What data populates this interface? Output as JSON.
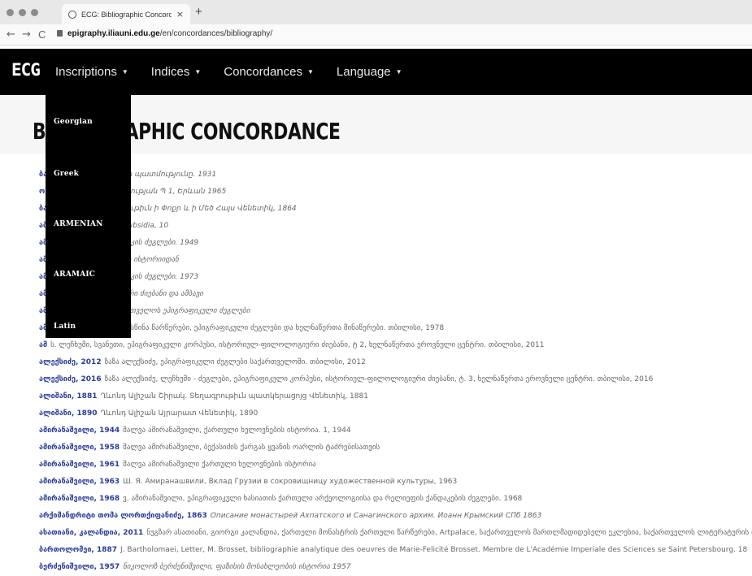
{
  "browser": {
    "tab_title": "ECG: Bibliographic Concordan",
    "tab_close": "×",
    "new_tab": "+",
    "url_domain": "epigraphy.iliauni.edu.ge",
    "url_path": "/en/concordances/bibliography/",
    "back": "←",
    "forward": "→",
    "reload": "C"
  },
  "nav": {
    "brand": "ECG",
    "menu": [
      {
        "label": "Inscriptions"
      },
      {
        "label": "Indices"
      },
      {
        "label": "Concordances"
      },
      {
        "label": "Language"
      }
    ],
    "caret": "▼"
  },
  "page": {
    "title": "BIBLIOGRAPHIC CONCORDANCE"
  },
  "dropdown": {
    "items": [
      "Georgian",
      "Greek",
      "ARMENIAN",
      "ARAMAIC",
      "Latin"
    ]
  },
  "rows": [
    {
      "key": "ბა",
      "text": "Ալիշան, Հայաստանի պատմությունը. 1931"
    },
    {
      "key": "ო",
      "text": "ի Դիվան հայ վիմագրության Պ 1, Երևան 1965"
    },
    {
      "key": "ბა",
      "text": "Սիրանյան, Տեղագրութիւն ի Փոքր և ի Մեծ Հայս Վենետիկ, 1864"
    },
    {
      "key": "ამ",
      "text": "MIA CSCO. Vol 166. Subsidia, 10"
    },
    {
      "key": "ამ",
      "text": "ს. ქართული ეპიგრაფიკის ძეგლები. 1949"
    },
    {
      "key": "ამ",
      "text": "დეპები. საქართველოს ისტორიიდან"
    },
    {
      "key": "ამ",
      "text": "ს. ქართული ეპიგრაფიკის ძეგლები. 1973"
    },
    {
      "key": "ამ",
      "text": "დეპები. არქეოლოგიური ძიებანი და ამბავი"
    },
    {
      "key": "ამ",
      "text": "ს. აღმოსავლეთ საქართველოს ეპიგრაფიკული ძეგლები"
    },
    {
      "key": "ამ",
      "text": "ს. აქები სიონის ბოლოსწინა წარწერები, ეპიგრაფიკული ძეგლები და ხელნაწერთა მინაწერები. თბილისი, 1978"
    },
    {
      "key": "ამ",
      "text": "ს. ლეჩხუმი, სვანეთი, ეპიგრაფიკული კორპუსი, ისტორიულ-ფილოლოგიური ძიებანი, ტ 2, ხელნაწერთა ეროვნული ცენტრი. თბილისი, 2011"
    },
    {
      "key": "ალექსიძე, 2012",
      "text": "ზაზა ალექსიძე, ეპიგრაფიკული ძეგლები საქართველოში. თბილისი, 2012"
    },
    {
      "key": "ალექსიძე, 2016",
      "text": "ზაზა ალექსიძე, ლეჩხუმი - ძეგლები, ეპიგრაფიკული კორპუსი, ისტორიულ-ფილოლოგიური ძიებანი, ტ. 3, ხელნაწერთა ეროვნული ცენტრი. თბილისი, 2016"
    },
    {
      "key": "ალიშანი, 1881",
      "text": "Ղևոնդ Ալիշան Շիրակ. Տեղագրութիւն պատկերացոյց Վենետիկ, 1881"
    },
    {
      "key": "ალიშანი, 1890",
      "text": "Ղևոնդ Ալիշան Այրարատ Վենետիկ, 1890"
    },
    {
      "key": "ამირანაშვილი, 1944",
      "text": "შალვა ამირანაშვილი, ქართული ხელოვნების ისტორია. 1, 1944"
    },
    {
      "key": "ამირანაშვილი, 1958",
      "text": "შალვა ამირანაშვილი, ბექასიძის ქარგას ყვანის ოარლის ტაძრებისათვის"
    },
    {
      "key": "ამირანაშვილი, 1961",
      "text": "შალვა ამირანაშვილი ქართული ხელოვნების ისტორია"
    },
    {
      "key": "ამირანაშვილი, 1963",
      "text": "Ш. Я. Амиранашвили, Вклад Грузии в сокровищницу художественной культуры, 1963"
    },
    {
      "key": "ამირანაშვილი, 1968",
      "text": "ვ. ამირანაშვილი, ეპიგრაფიკული ხასიათის ქართული არქეოლოგიისა და რელიეფის ქანდაკების ძეგლები. 1968"
    },
    {
      "key": "არქიმანდრიტი თომა ლორთქიფანიძე, 1863",
      "text": "Описание монастырей Ахпатского и Санагинского архим. Иоанн Крымский СПб 1863"
    },
    {
      "key": "ასათიანი, კალანდია, 2011",
      "text": "ნუგზარ ასათიანი, გიორგი კალანდია, ქართული მონასტრის ქართული წარწერები, Artpalace, საქართველოს მართლმადიდებელი ეკლესია, საქართველოს ლიტერატურის თეატრი, მუზეუმი, კინო და ქორეოგრაფია"
    },
    {
      "key": "ბართოლომეი, 1887",
      "text": "J. Bartholomaei, Letter, M. Brosset, bibliographie analytique des oeuvres de Marie-Felicité Brosset. Membre de L'Académie Imperiale des Sciences se Saint Petersbourg. 18"
    },
    {
      "key": "ბერძენიშვილი, 1957",
      "text": "ნიკოლოზ ბერძენიშვილი, ფაზისის მოსახლეობის ისტორია 1957"
    }
  ]
}
